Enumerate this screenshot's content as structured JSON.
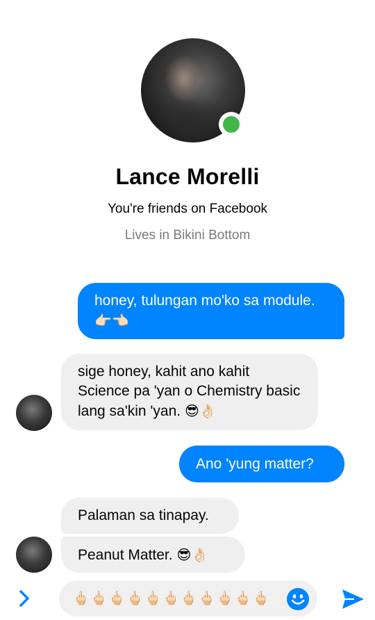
{
  "profile": {
    "name": "Lance Morelli",
    "friends_text": "You're friends on Facebook",
    "lives_text": "Lives in Bikini Bottom",
    "online": true
  },
  "messages": [
    {
      "sender": "me",
      "text": "honey, tulungan mo'ko sa module.",
      "emoji": "👉🏻👈🏻"
    },
    {
      "sender": "them",
      "text": "sige honey, kahit ano kahit Science pa 'yan o Chemistry basic lang sa'kin 'yan.",
      "emoji": "😎👌🏻"
    },
    {
      "sender": "me",
      "text": "Ano 'yung matter?",
      "emoji": ""
    },
    {
      "sender": "them",
      "text": "Palaman sa tinapay.",
      "emoji": ""
    },
    {
      "sender": "them",
      "text": "Peanut Matter.",
      "emoji": "😎👌🏻"
    }
  ],
  "composer": {
    "value": "🖕🏻🖕🏻🖕🏻🖕🏻🖕🏻🖕🏻🖕🏻🖕🏻🖕🏻🖕🏻🖕🏻🖕🏻",
    "expand_icon": "chevron-right-icon",
    "emoji_icon": "smiley-icon",
    "send_icon": "send-icon"
  },
  "colors": {
    "accent": "#0084ff",
    "online": "#44b649",
    "incoming_bubble": "#efefef",
    "subtext": "#7a7a7a"
  }
}
